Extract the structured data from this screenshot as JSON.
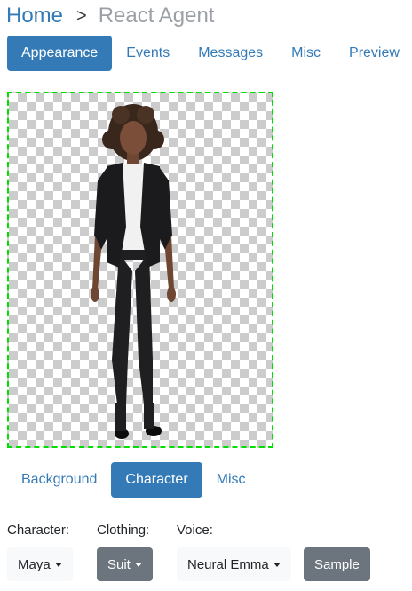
{
  "breadcrumb": {
    "home": "Home",
    "separator": ">",
    "current": "React Agent"
  },
  "tabs": [
    {
      "label": "Appearance",
      "active": true
    },
    {
      "label": "Events",
      "active": false
    },
    {
      "label": "Messages",
      "active": false
    },
    {
      "label": "Misc",
      "active": false
    },
    {
      "label": "Preview",
      "active": false
    }
  ],
  "sub_tabs": [
    {
      "label": "Background",
      "active": false
    },
    {
      "label": "Character",
      "active": true
    },
    {
      "label": "Misc",
      "active": false
    }
  ],
  "fields": {
    "character": {
      "label": "Character:",
      "value": "Maya"
    },
    "clothing": {
      "label": "Clothing:",
      "value": "Suit"
    },
    "voice": {
      "label": "Voice:",
      "value": "Neural Emma"
    },
    "sample_button": "Sample"
  },
  "colors": {
    "primary": "#337ab7",
    "secondary": "#6c757d",
    "light": "#f8f9fa",
    "frame_border": "#00e000"
  }
}
